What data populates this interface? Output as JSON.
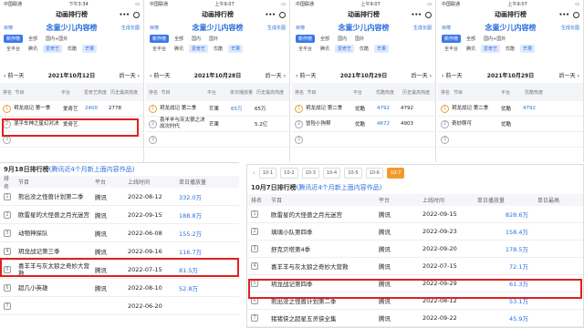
{
  "colors": {
    "accent": "#2a6fdb",
    "highlight": "#e02020",
    "orange": "#f39a2d"
  },
  "phones": [
    {
      "carrier": "中国联通",
      "time": "下午3:34",
      "battery": "",
      "app_title": "动画排行榜",
      "menu": "目榜",
      "title": "念童少儿内容榜",
      "gen": "生成长图",
      "chips1": [
        "新作榜",
        "全部",
        "国内+国外"
      ],
      "chips2": [
        "全平台",
        "腾讯",
        "爱奇艺",
        "优酷",
        "芒果"
      ],
      "prev": "前一天",
      "date": "2021年10月12日",
      "next": "后一天",
      "headers": [
        "排名",
        "节目",
        "平台",
        "爱奇艺热度",
        "历史最高热度"
      ],
      "rows": [
        {
          "n": "1",
          "name": "玥龙战记 第一季",
          "plat": "爱奇艺",
          "v1": "2400",
          "v2": "2778"
        },
        {
          "n": "2",
          "name": "混乎车神之星幻对决",
          "plat": "爱奇艺",
          "v1": "",
          "v2": ""
        },
        {
          "n": "3",
          "name": "",
          "plat": "",
          "v1": "",
          "v2": ""
        }
      ]
    },
    {
      "carrier": "中国联通",
      "time": "上午9:07",
      "battery": "",
      "app_title": "动画排行榜",
      "menu": "目榜",
      "title": "念童少儿内容榜",
      "gen": "生成长图",
      "chips1": [
        "新作榜",
        "全部",
        "国内",
        "国外"
      ],
      "chips2": [
        "全平台",
        "腾讯",
        "爱奇艺",
        "优酷",
        "芒果"
      ],
      "prev": "前一天",
      "date": "2021年10月28日",
      "next": "后一天",
      "headers": [
        "排名",
        "节目",
        "平台",
        "单日播放量",
        "历史最高热度"
      ],
      "rows": [
        {
          "n": "1",
          "name": "玥龙战记 第二季",
          "plat": "芒果",
          "v1": "65万",
          "v2": "65万"
        },
        {
          "n": "2",
          "name": "喜羊羊与灰太狼之决战次时代",
          "plat": "芒果",
          "v1": "",
          "v2": "5.2亿"
        },
        {
          "n": "3",
          "name": "",
          "plat": "",
          "v1": "",
          "v2": ""
        }
      ]
    },
    {
      "carrier": "中国联通",
      "time": "上午9:07",
      "battery": "",
      "app_title": "动画排行榜",
      "menu": "目榜",
      "title": "念童少儿内容榜",
      "gen": "生成长图",
      "chips1": [
        "新作榜",
        "全部",
        "国内",
        "国外"
      ],
      "chips2": [
        "全平台",
        "腾讯",
        "爱奇艺",
        "优酷",
        "芒果"
      ],
      "prev": "前一天",
      "date": "2021年10月29日",
      "next": "后一天",
      "headers": [
        "排名",
        "节目",
        "平台",
        "优酷热度",
        "历史最高热度"
      ],
      "rows": [
        {
          "n": "1",
          "name": "玥龙战记 第二季",
          "plat": "优酷",
          "v1": "4792",
          "v2": "4792"
        },
        {
          "n": "2",
          "name": "冒险小狗帮",
          "plat": "优酷",
          "v1": "4672",
          "v2": "4903"
        },
        {
          "n": "3",
          "name": "",
          "plat": "",
          "v1": "",
          "v2": ""
        }
      ]
    },
    {
      "carrier": "中国联通",
      "time": "上午9:07",
      "battery": "",
      "app_title": "动画排行榜",
      "menu": "目榜",
      "title": "念童少儿内容榜",
      "gen": "生成长图",
      "chips1": [
        "新作榜",
        "全部",
        "国内+国外"
      ],
      "chips2": [
        "全平台",
        "腾讯",
        "爱奇艺",
        "优酷",
        "芒果"
      ],
      "prev": "前一天",
      "date": "2021年10月29日",
      "next": "后一天",
      "headers": [
        "排名",
        "节目",
        "平台",
        "优酷热度"
      ],
      "rows": [
        {
          "n": "1",
          "name": "玥龙战记 第二季",
          "plat": "优酷",
          "v1": "4792",
          "v2": ""
        },
        {
          "n": "2",
          "name": "奇妙萌可",
          "plat": "优酷",
          "v1": "",
          "v2": ""
        },
        {
          "n": "3",
          "name": "",
          "plat": "",
          "v1": "",
          "v2": ""
        }
      ]
    }
  ],
  "left_table": {
    "title": "9月18日排行榜",
    "sub": "(腾讯近4个月新上面内容作品)",
    "headers": [
      "排名",
      "节目",
      "平台",
      "上线时间",
      "单日播放量"
    ],
    "rows": [
      {
        "n": "1",
        "name": "熊出没之怪兽计划第二季",
        "plat": "腾讯",
        "date": "2022-08-12",
        "val": "332.0万"
      },
      {
        "n": "2",
        "name": "欧雷星的大怪兽之月光迷宫",
        "plat": "腾讯",
        "date": "2022-09-15",
        "val": "188.8万"
      },
      {
        "n": "3",
        "name": "动物神探队",
        "plat": "腾讯",
        "date": "2022-06-08",
        "val": "155.2万"
      },
      {
        "n": "4",
        "name": "玥龙战记第三季",
        "plat": "腾讯",
        "date": "2022-09-16",
        "val": "116.7万"
      },
      {
        "n": "5",
        "name": "喜羊羊与灰太狼之奇妙大营救",
        "plat": "腾讯",
        "date": "2022-07-15",
        "val": "81.5万"
      },
      {
        "n": "6",
        "name": "超几小英雄",
        "plat": "腾讯",
        "date": "2022-08-10",
        "val": "52.8万"
      },
      {
        "n": "7",
        "name": "",
        "plat": "",
        "date": "2022-06-20",
        "val": ""
      }
    ]
  },
  "right_table": {
    "tabs": [
      "10-1",
      "10-2",
      "10-3",
      "10-4",
      "10-5",
      "10-6",
      "10-7"
    ],
    "title": "10月7日排行榜",
    "sub": "(腾讯近4个月新上面内容作品)",
    "headers": [
      "排名",
      "节目",
      "平台",
      "上线时间",
      "单日播放量",
      "单日最高"
    ],
    "rows": [
      {
        "n": "1",
        "name": "欧雷星的大怪兽之月光迷宫",
        "plat": "腾讯",
        "date": "2022-09-15",
        "val": "828.6万"
      },
      {
        "n": "2",
        "name": "璃璃小队第四季",
        "plat": "腾讯",
        "date": "2022-09-23",
        "val": "158.4万"
      },
      {
        "n": "3",
        "name": "舒克贝塔第4季",
        "plat": "腾讯",
        "date": "2022-09-20",
        "val": "178.5万"
      },
      {
        "n": "4",
        "name": "喜羊羊与灰太狼之奇妙大营救",
        "plat": "腾讯",
        "date": "2022-07-15",
        "val": "72.1万"
      },
      {
        "n": "5",
        "name": "玥龙战记第四季",
        "plat": "腾讯",
        "date": "2022-09-29",
        "val": "61.3万"
      },
      {
        "n": "6",
        "name": "熊出没之怪兽计划第二季",
        "plat": "腾讯",
        "date": "2022-08-12",
        "val": "53.1万"
      },
      {
        "n": "7",
        "name": "猪猪侠之超星五灵侠全集",
        "plat": "腾讯",
        "date": "2022-09-22",
        "val": "45.9万"
      }
    ]
  }
}
